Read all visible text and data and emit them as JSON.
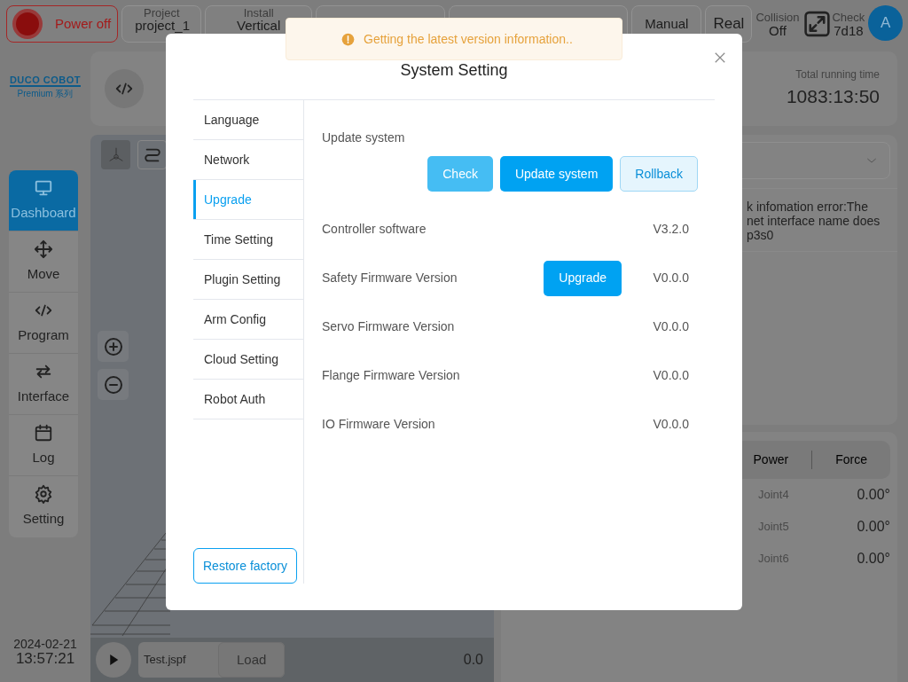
{
  "top_bar": {
    "power_button": "Power off",
    "status_items": [
      {
        "label": "Project",
        "value": "project_1"
      },
      {
        "label": "Install",
        "value": "Vertical"
      }
    ],
    "mode_buttons": [
      "Manual",
      "Real"
    ],
    "collision": {
      "label": "Collision",
      "value": "Off"
    },
    "check": {
      "label": "Check",
      "value": "7d18"
    },
    "avatar": "A"
  },
  "logo": {
    "brand": "DUCO COBOT",
    "series": "Premium 系列"
  },
  "nav": [
    {
      "label": "Dashboard",
      "selected": true
    },
    {
      "label": "Move",
      "selected": false
    },
    {
      "label": "Program",
      "selected": false
    },
    {
      "label": "Interface",
      "selected": false
    },
    {
      "label": "Log",
      "selected": false
    },
    {
      "label": "Setting",
      "selected": false
    }
  ],
  "running_time": {
    "label": "Total running time",
    "value": "1083:13:50"
  },
  "log_message_lines": [
    "k infomation error:The",
    "net interface name does",
    "p3s0"
  ],
  "joint_tabs": [
    "Power",
    "Force"
  ],
  "joints": [
    {
      "name": "Joint4",
      "value": "0.00°"
    },
    {
      "name": "Joint5",
      "value": "0.00°"
    },
    {
      "name": "Joint6",
      "value": "0.00°"
    }
  ],
  "clock": {
    "date": "2024-02-21",
    "time": "13:57:21"
  },
  "program_bar": {
    "file": "Test.jspf",
    "load": "Load",
    "speed": "0.0"
  },
  "toast": {
    "kind": "warning",
    "text": "Getting the latest version information.."
  },
  "dialog": {
    "title": "System Setting",
    "menu": [
      {
        "label": "Language",
        "selected": false
      },
      {
        "label": "Network",
        "selected": false
      },
      {
        "label": "Upgrade",
        "selected": true
      },
      {
        "label": "Time Setting",
        "selected": false
      },
      {
        "label": "Plugin Setting",
        "selected": false
      },
      {
        "label": "Arm Config",
        "selected": false
      },
      {
        "label": "Cloud Setting",
        "selected": false
      },
      {
        "label": "Robot Auth",
        "selected": false
      }
    ],
    "restore_button": "Restore factory",
    "section_title": "Update system",
    "actions": [
      {
        "label": "Check",
        "kind": "light"
      },
      {
        "label": "Update system",
        "kind": "primary"
      },
      {
        "label": "Rollback",
        "kind": "plain"
      }
    ],
    "rows": [
      {
        "label": "Controller software",
        "value": "V3.2.0"
      },
      {
        "label": "Safety Firmware Version",
        "action": "Upgrade",
        "value": "V0.0.0"
      },
      {
        "label": "Servo Firmware Version",
        "value": "V0.0.0"
      },
      {
        "label": "Flange Firmware Version",
        "value": "V0.0.0"
      },
      {
        "label": "IO Firmware Version",
        "value": "V0.0.0"
      }
    ]
  }
}
